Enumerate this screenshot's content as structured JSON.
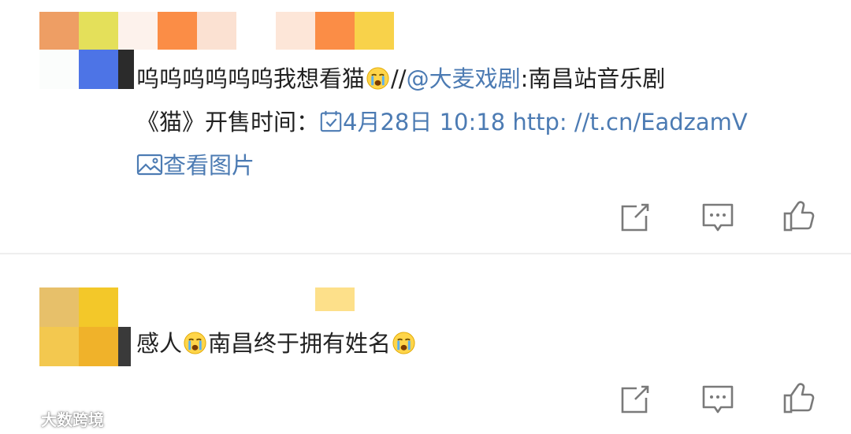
{
  "posts": [
    {
      "text_line1_a": "呜呜呜呜呜呜我想看猫",
      "text_line1_b": "//",
      "mention": "@大麦戏剧",
      "text_line1_c": ":南昌站音乐剧",
      "text_line2_a": "《猫》开售时间：",
      "date_text": "4月28日 10:18",
      "url_text": "http:  //t.cn/EadzamV",
      "view_image_label": "查看图片",
      "emoji_name": "crying-face-icon"
    },
    {
      "text_a": "感人",
      "text_b": "南昌终于拥有姓名",
      "emoji_name": "crying-face-icon"
    }
  ],
  "actions": {
    "share_icon": "share-icon",
    "comment_icon": "comment-icon",
    "like_icon": "thumbs-up-icon"
  },
  "watermark": {
    "text": "大数跨境"
  },
  "colors": {
    "link": "#4c7bb3",
    "text": "#222222",
    "icon_gray": "#7a7a7a",
    "divider": "#eeeeee"
  }
}
